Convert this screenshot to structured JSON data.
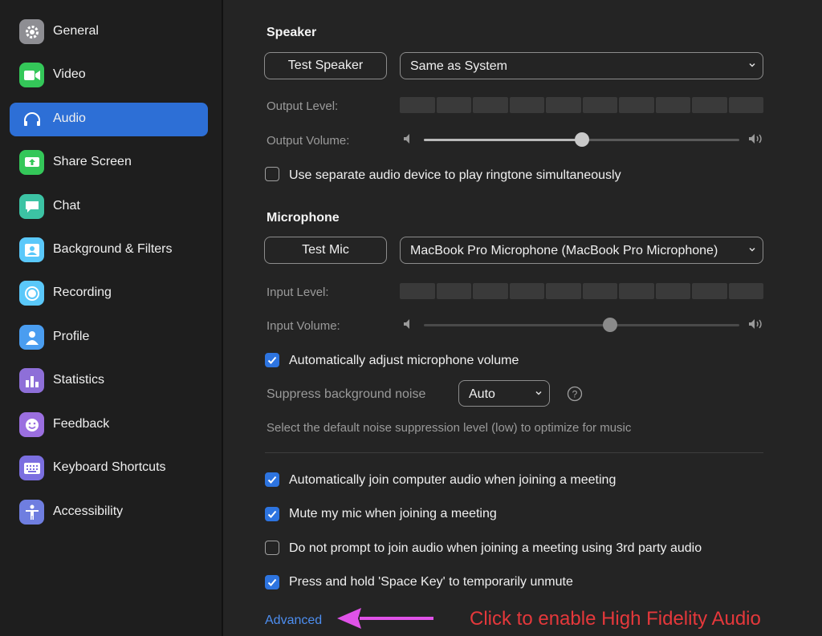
{
  "sidebar": {
    "items": [
      {
        "label": "General",
        "icon": "gear-icon",
        "color": "#8e8e93"
      },
      {
        "label": "Video",
        "icon": "video-camera-icon",
        "color": "#34c759"
      },
      {
        "label": "Audio",
        "icon": "headphones-icon",
        "color": "#2d6fd6",
        "active": true
      },
      {
        "label": "Share Screen",
        "icon": "share-screen-icon",
        "color": "#34c759"
      },
      {
        "label": "Chat",
        "icon": "chat-bubble-icon",
        "color": "#3cc3a4"
      },
      {
        "label": "Background & Filters",
        "icon": "background-portrait-icon",
        "color": "#5ac8fa"
      },
      {
        "label": "Recording",
        "icon": "record-icon",
        "color": "#5ac8fa"
      },
      {
        "label": "Profile",
        "icon": "person-icon",
        "color": "#4a9df0"
      },
      {
        "label": "Statistics",
        "icon": "bar-chart-icon",
        "color": "#8e6fd8"
      },
      {
        "label": "Feedback",
        "icon": "smiley-icon",
        "color": "#9b6fe0"
      },
      {
        "label": "Keyboard Shortcuts",
        "icon": "keyboard-icon",
        "color": "#7b6fe0"
      },
      {
        "label": "Accessibility",
        "icon": "accessibility-person-icon",
        "color": "#6f7ee0"
      }
    ]
  },
  "speaker": {
    "title": "Speaker",
    "test_button": "Test Speaker",
    "device": "Same as System",
    "output_level_label": "Output Level:",
    "output_volume_label": "Output Volume:",
    "output_volume": 0.5,
    "ringtone_checkbox": {
      "label": "Use separate audio device to play ringtone simultaneously",
      "checked": false
    }
  },
  "microphone": {
    "title": "Microphone",
    "test_button": "Test Mic",
    "device": "MacBook Pro Microphone (MacBook Pro Microphone)",
    "input_level_label": "Input Level:",
    "input_volume_label": "Input Volume:",
    "input_volume": 0.59,
    "auto_adjust": {
      "label": "Automatically adjust microphone volume",
      "checked": true
    },
    "suppress_label": "Suppress background noise",
    "suppress_value": "Auto",
    "suppress_hint": "Select the default noise suppression level (low) to optimize for music"
  },
  "options": [
    {
      "label": "Automatically join computer audio when joining a meeting",
      "checked": true
    },
    {
      "label": "Mute my mic when joining a meeting",
      "checked": true
    },
    {
      "label": "Do not prompt to join audio when joining a meeting using 3rd party audio",
      "checked": false
    },
    {
      "label": "Press and hold 'Space Key' to temporarily unmute",
      "checked": true
    }
  ],
  "advanced_link": "Advanced",
  "annotation": "Click to enable High Fidelity Audio",
  "colors": {
    "accent": "#2d6fd6",
    "annotation": "#e5383b",
    "arrow": "#e052e8",
    "link": "#4d8ef0"
  }
}
